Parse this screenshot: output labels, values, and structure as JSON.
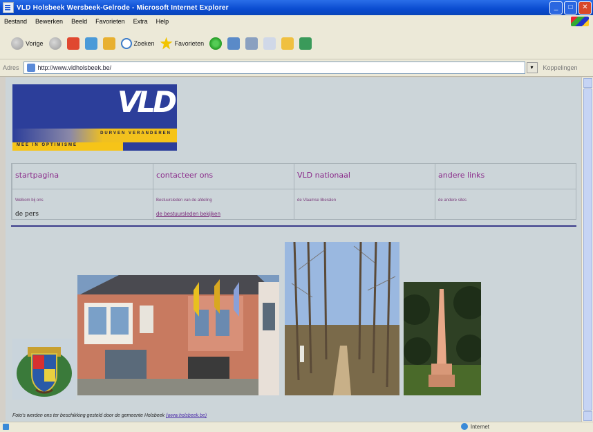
{
  "window": {
    "title": "VLD Holsbeek Wersbeek-Gelrode - Microsoft Internet Explorer",
    "min_glyph": "_",
    "max_glyph": "□",
    "close_glyph": "✕"
  },
  "menu": [
    "Bestand",
    "Bewerken",
    "Beeld",
    "Favorieten",
    "Extra",
    "Help"
  ],
  "toolbar": {
    "back_label": "Vorige",
    "search_label": "Zoeken",
    "favorites_label": "Favorieten"
  },
  "address": {
    "label": "Adres",
    "url": "http://www.vldholsbeek.be/",
    "go_glyph": "▾",
    "links_label": "Koppelingen"
  },
  "logo": {
    "brand": "VLD",
    "slogan": "DURVEN VERANDEREN",
    "slogan2": "MEE IN OPTIMISME"
  },
  "nav": [
    {
      "head": "startpagina",
      "sub": "Welkom bij ons",
      "sub2": "de pers",
      "sub2_style": "plain"
    },
    {
      "head": "contacteer ons",
      "sub": "Bestuursleden van de afdeling",
      "sub2": "de bestuursleden bekijken",
      "sub2_style": "link"
    },
    {
      "head": "VLD nationaal",
      "sub": "de Vlaamse liberalen",
      "sub2": "",
      "sub2_style": "plain"
    },
    {
      "head": "andere links",
      "sub": "de andere sites",
      "sub2": "",
      "sub2_style": "plain"
    }
  ],
  "caption": {
    "text": "Foto's werden ons ter beschikking gesteld door de gemeente Holsbeek",
    "link": "(www.holsbeek.be)"
  },
  "status": {
    "zone": "Internet"
  },
  "colors": {
    "page_bg": "#ccd5d9",
    "nav_text": "#8a2a8a",
    "divider": "#3a3a8a",
    "logo_blue": "#2c3e9a",
    "logo_yellow": "#f6c418"
  }
}
